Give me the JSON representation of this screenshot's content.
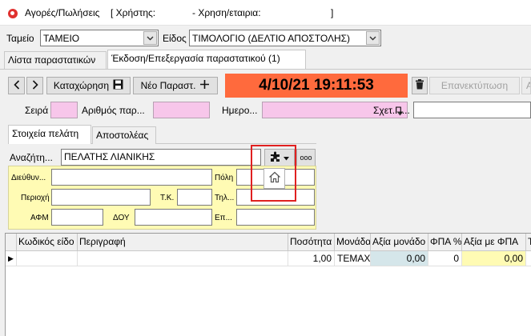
{
  "window": {
    "title": "Αγορές/Πωλήσεις",
    "user_label": "[ Χρήστης:",
    "year_company_label": "- Χρηση/εταιρια:",
    "close_bracket": "]"
  },
  "header": {
    "tameio_label": "Ταμείο",
    "tameio_value": "ΤΑΜΕΙΟ",
    "eidos_label": "Είδος",
    "eidos_value": "ΤΙΜΟΛΟΓΙΟ (ΔΕΛΤΙΟ ΑΠΟΣΤΟΛΗΣ)"
  },
  "main_tabs": [
    {
      "label": "Λίστα παραστατικών"
    },
    {
      "label": "Έκδοση/Επεξεργασία παραστατικού (1)"
    }
  ],
  "toolbar": {
    "save_label": "Καταχώρηση",
    "new_label": "Νέο Παραστ.",
    "datetime": "4/10/21 19:11:53",
    "reprint_label": "Επανεκτύπωση",
    "cut_label": "Α"
  },
  "doc_fields": {
    "seira_label": "Σειρά",
    "arithmos_label": "Αριθμός παρ...",
    "hmero_label": "Ημερο...",
    "sxet_label": "Σχετ.Π..."
  },
  "sub_tabs": [
    {
      "label": "Στοιχεία πελάτη"
    },
    {
      "label": "Αποστολέας"
    }
  ],
  "customer": {
    "search_label": "Αναζήτη...",
    "search_value": "ΠΕΛΑΤΗΣ ΛΙΑΝΙΚΗΣ",
    "more_label": "ooo",
    "address_label": "Διεύθυν...",
    "city_label": "Πόλη",
    "area_label": "Περιοχή",
    "tk_label": "Τ.Κ.",
    "phone_label": "Τηλ...",
    "afm_label": "ΑΦΜ",
    "doy_label": "ΔΟΥ",
    "ep_label": "Επ..."
  },
  "grid": {
    "columns": [
      "Κωδικός είδο",
      "Περιγραφή",
      "Ποσότητα",
      "Μονάδα",
      "Αξία μονάδο",
      "ΦΠΑ %",
      "Αξία με ΦΠΑ",
      "Τ"
    ],
    "rows": [
      {
        "indicator": "▶",
        "code": "",
        "description": "",
        "quantity": "1,00",
        "unit": "ΤΕΜΑΧ",
        "unit_value": "0,00",
        "vat": "0",
        "value_with_vat": "0,00",
        "t": ""
      }
    ]
  },
  "colors": {
    "datetime_bg": "#ff6a3d",
    "pink_field": "#f7c6ea",
    "yellow_panel": "#fffbb4",
    "highlight": "#e02020"
  }
}
